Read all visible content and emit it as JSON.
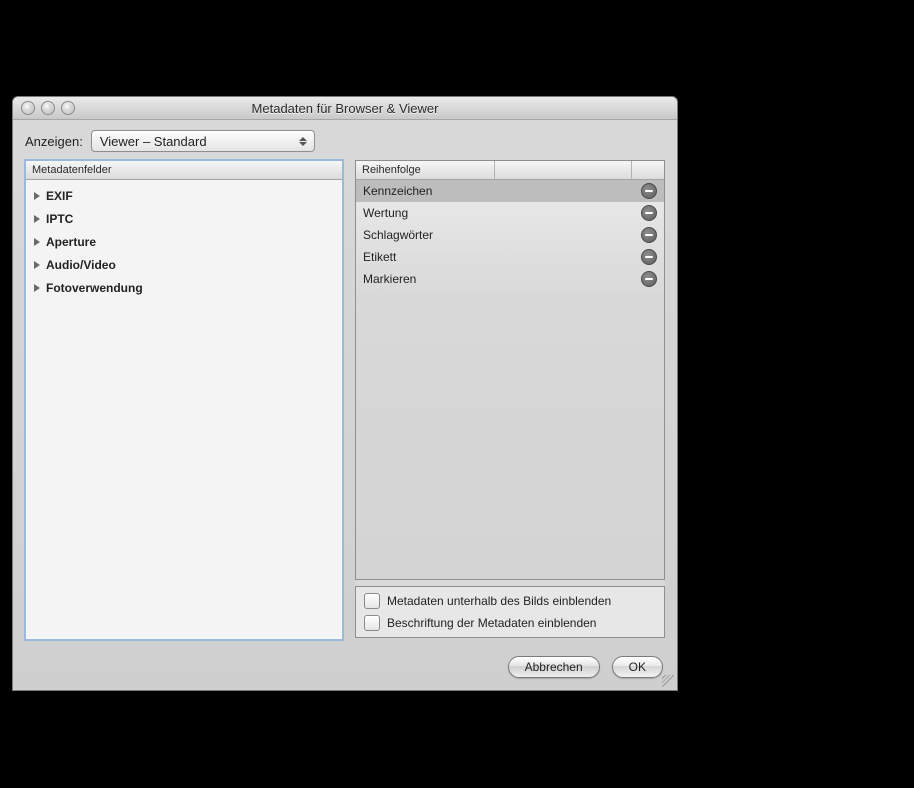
{
  "window": {
    "title": "Metadaten für Browser & Viewer"
  },
  "toolbar": {
    "show_label": "Anzeigen:",
    "popup_value": "Viewer – Standard"
  },
  "left_panel": {
    "header": "Metadatenfelder",
    "items": [
      {
        "label": "EXIF"
      },
      {
        "label": "IPTC"
      },
      {
        "label": "Aperture"
      },
      {
        "label": "Audio/Video"
      },
      {
        "label": "Fotoverwendung"
      }
    ]
  },
  "right_panel": {
    "header": "Reihenfolge",
    "rows": [
      {
        "label": "Kennzeichen",
        "selected": true
      },
      {
        "label": "Wertung",
        "selected": false
      },
      {
        "label": "Schlagwörter",
        "selected": false
      },
      {
        "label": "Etikett",
        "selected": false
      },
      {
        "label": "Markieren",
        "selected": false
      }
    ],
    "checkbox1": "Metadaten unterhalb des Bilds einblenden",
    "checkbox2": "Beschriftung der Metadaten einblenden"
  },
  "buttons": {
    "cancel": "Abbrechen",
    "ok": "OK"
  }
}
